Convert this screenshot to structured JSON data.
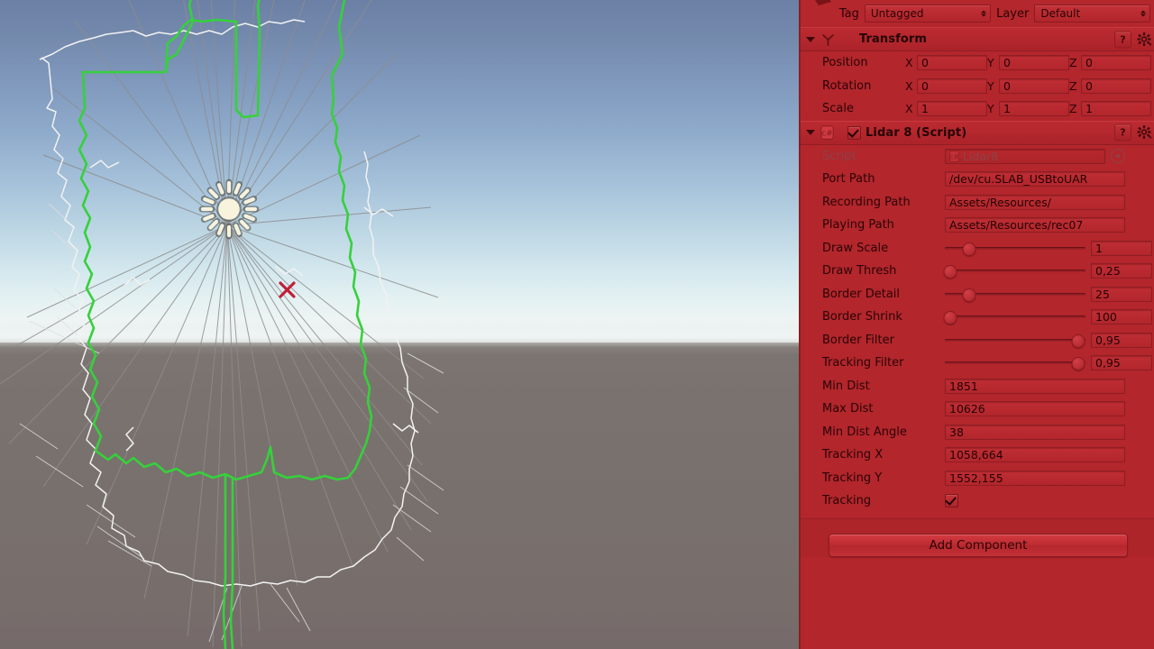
{
  "scene": {
    "name": "scene-view",
    "sky_top_color": "#6c80a6",
    "sky_horizon_color": "#eef4f3",
    "ground_color": "#78706c",
    "lidar_border_color": "#35d13b",
    "lidar_points_color": "#ffffff",
    "lidar_rays_color": "#8a8a8a",
    "marker_color": "#c02038",
    "marker_label": "x",
    "light_gizmo_label": "directional-light-gizmo"
  },
  "inspector": {
    "tag_label": "Tag",
    "tag_value": "Untagged",
    "layer_label": "Layer",
    "layer_value": "Default",
    "transform": {
      "title": "Transform",
      "help_label": "?",
      "rows": [
        {
          "label": "Position",
          "x": "0",
          "y": "0",
          "z": "0"
        },
        {
          "label": "Rotation",
          "x": "0",
          "y": "0",
          "z": "0"
        },
        {
          "label": "Scale",
          "x": "1",
          "y": "1",
          "z": "1"
        }
      ],
      "axis_x": "X",
      "axis_y": "Y",
      "axis_z": "Z"
    },
    "script_component": {
      "title": "Lidar 8 (Script)",
      "enabled": true,
      "help_label": "?",
      "script_field": {
        "label": "Script",
        "value": "Lidar8"
      },
      "text_fields": [
        {
          "label": "Port Path",
          "value": "/dev/cu.SLAB_USBtoUAR"
        },
        {
          "label": "Recording Path",
          "value": "Assets/Resources/"
        },
        {
          "label": "Playing Path",
          "value": "Assets/Resources/rec07"
        }
      ],
      "sliders": [
        {
          "label": "Draw Scale",
          "value": "1",
          "pos": 17
        },
        {
          "label": "Draw Thresh",
          "value": "0,25",
          "pos": 4
        },
        {
          "label": "Border Detail",
          "value": "25",
          "pos": 17
        },
        {
          "label": "Border Shrink",
          "value": "100",
          "pos": 4
        },
        {
          "label": "Border Filter",
          "value": "0,95",
          "pos": 95
        },
        {
          "label": "Tracking Filter",
          "value": "0,95",
          "pos": 95
        }
      ],
      "numbers": [
        {
          "label": "Min Dist",
          "value": "1851"
        },
        {
          "label": "Max Dist",
          "value": "10626"
        },
        {
          "label": "Min Dist Angle",
          "value": "38"
        },
        {
          "label": "Tracking X",
          "value": "1058,664"
        },
        {
          "label": "Tracking Y",
          "value": "1552,155"
        }
      ],
      "toggle": {
        "label": "Tracking",
        "checked": true
      }
    },
    "add_component_label": "Add Component"
  }
}
